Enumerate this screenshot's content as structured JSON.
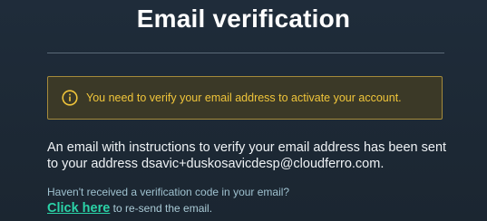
{
  "page": {
    "title": "Email verification"
  },
  "alert": {
    "icon": "info-icon",
    "message": "You need to verify your email address to activate your account.",
    "color": "#f0c53a"
  },
  "info": {
    "line1": "An email with instructions to verify your email address has been sent",
    "line2": "to your address dsavic+duskosavicdesp@cloudferro.com."
  },
  "help": {
    "question": "Haven't received a verification code in your email?",
    "link_label": "Click here",
    "link_suffix": " to re-send the email."
  },
  "colors": {
    "accent": "#2bd3a8",
    "warning_border": "#a58b3b"
  }
}
